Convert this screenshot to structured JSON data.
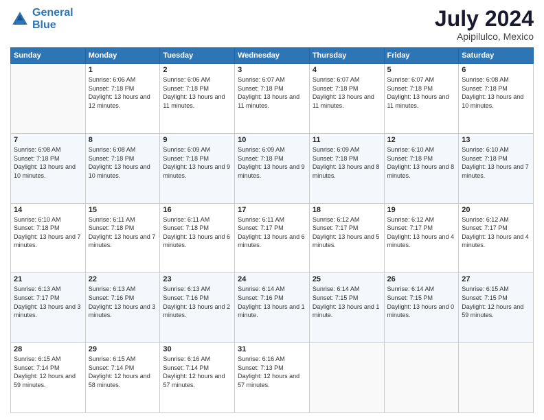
{
  "logo": {
    "line1": "General",
    "line2": "Blue"
  },
  "title": "July 2024",
  "location": "Apipilulco, Mexico",
  "weekdays": [
    "Sunday",
    "Monday",
    "Tuesday",
    "Wednesday",
    "Thursday",
    "Friday",
    "Saturday"
  ],
  "weeks": [
    [
      {
        "day": "",
        "sunrise": "",
        "sunset": "",
        "daylight": ""
      },
      {
        "day": "1",
        "sunrise": "Sunrise: 6:06 AM",
        "sunset": "Sunset: 7:18 PM",
        "daylight": "Daylight: 13 hours and 12 minutes."
      },
      {
        "day": "2",
        "sunrise": "Sunrise: 6:06 AM",
        "sunset": "Sunset: 7:18 PM",
        "daylight": "Daylight: 13 hours and 11 minutes."
      },
      {
        "day": "3",
        "sunrise": "Sunrise: 6:07 AM",
        "sunset": "Sunset: 7:18 PM",
        "daylight": "Daylight: 13 hours and 11 minutes."
      },
      {
        "day": "4",
        "sunrise": "Sunrise: 6:07 AM",
        "sunset": "Sunset: 7:18 PM",
        "daylight": "Daylight: 13 hours and 11 minutes."
      },
      {
        "day": "5",
        "sunrise": "Sunrise: 6:07 AM",
        "sunset": "Sunset: 7:18 PM",
        "daylight": "Daylight: 13 hours and 11 minutes."
      },
      {
        "day": "6",
        "sunrise": "Sunrise: 6:08 AM",
        "sunset": "Sunset: 7:18 PM",
        "daylight": "Daylight: 13 hours and 10 minutes."
      }
    ],
    [
      {
        "day": "7",
        "sunrise": "Sunrise: 6:08 AM",
        "sunset": "Sunset: 7:18 PM",
        "daylight": "Daylight: 13 hours and 10 minutes."
      },
      {
        "day": "8",
        "sunrise": "Sunrise: 6:08 AM",
        "sunset": "Sunset: 7:18 PM",
        "daylight": "Daylight: 13 hours and 10 minutes."
      },
      {
        "day": "9",
        "sunrise": "Sunrise: 6:09 AM",
        "sunset": "Sunset: 7:18 PM",
        "daylight": "Daylight: 13 hours and 9 minutes."
      },
      {
        "day": "10",
        "sunrise": "Sunrise: 6:09 AM",
        "sunset": "Sunset: 7:18 PM",
        "daylight": "Daylight: 13 hours and 9 minutes."
      },
      {
        "day": "11",
        "sunrise": "Sunrise: 6:09 AM",
        "sunset": "Sunset: 7:18 PM",
        "daylight": "Daylight: 13 hours and 8 minutes."
      },
      {
        "day": "12",
        "sunrise": "Sunrise: 6:10 AM",
        "sunset": "Sunset: 7:18 PM",
        "daylight": "Daylight: 13 hours and 8 minutes."
      },
      {
        "day": "13",
        "sunrise": "Sunrise: 6:10 AM",
        "sunset": "Sunset: 7:18 PM",
        "daylight": "Daylight: 13 hours and 7 minutes."
      }
    ],
    [
      {
        "day": "14",
        "sunrise": "Sunrise: 6:10 AM",
        "sunset": "Sunset: 7:18 PM",
        "daylight": "Daylight: 13 hours and 7 minutes."
      },
      {
        "day": "15",
        "sunrise": "Sunrise: 6:11 AM",
        "sunset": "Sunset: 7:18 PM",
        "daylight": "Daylight: 13 hours and 7 minutes."
      },
      {
        "day": "16",
        "sunrise": "Sunrise: 6:11 AM",
        "sunset": "Sunset: 7:18 PM",
        "daylight": "Daylight: 13 hours and 6 minutes."
      },
      {
        "day": "17",
        "sunrise": "Sunrise: 6:11 AM",
        "sunset": "Sunset: 7:17 PM",
        "daylight": "Daylight: 13 hours and 6 minutes."
      },
      {
        "day": "18",
        "sunrise": "Sunrise: 6:12 AM",
        "sunset": "Sunset: 7:17 PM",
        "daylight": "Daylight: 13 hours and 5 minutes."
      },
      {
        "day": "19",
        "sunrise": "Sunrise: 6:12 AM",
        "sunset": "Sunset: 7:17 PM",
        "daylight": "Daylight: 13 hours and 4 minutes."
      },
      {
        "day": "20",
        "sunrise": "Sunrise: 6:12 AM",
        "sunset": "Sunset: 7:17 PM",
        "daylight": "Daylight: 13 hours and 4 minutes."
      }
    ],
    [
      {
        "day": "21",
        "sunrise": "Sunrise: 6:13 AM",
        "sunset": "Sunset: 7:17 PM",
        "daylight": "Daylight: 13 hours and 3 minutes."
      },
      {
        "day": "22",
        "sunrise": "Sunrise: 6:13 AM",
        "sunset": "Sunset: 7:16 PM",
        "daylight": "Daylight: 13 hours and 3 minutes."
      },
      {
        "day": "23",
        "sunrise": "Sunrise: 6:13 AM",
        "sunset": "Sunset: 7:16 PM",
        "daylight": "Daylight: 13 hours and 2 minutes."
      },
      {
        "day": "24",
        "sunrise": "Sunrise: 6:14 AM",
        "sunset": "Sunset: 7:16 PM",
        "daylight": "Daylight: 13 hours and 1 minute."
      },
      {
        "day": "25",
        "sunrise": "Sunrise: 6:14 AM",
        "sunset": "Sunset: 7:15 PM",
        "daylight": "Daylight: 13 hours and 1 minute."
      },
      {
        "day": "26",
        "sunrise": "Sunrise: 6:14 AM",
        "sunset": "Sunset: 7:15 PM",
        "daylight": "Daylight: 13 hours and 0 minutes."
      },
      {
        "day": "27",
        "sunrise": "Sunrise: 6:15 AM",
        "sunset": "Sunset: 7:15 PM",
        "daylight": "Daylight: 12 hours and 59 minutes."
      }
    ],
    [
      {
        "day": "28",
        "sunrise": "Sunrise: 6:15 AM",
        "sunset": "Sunset: 7:14 PM",
        "daylight": "Daylight: 12 hours and 59 minutes."
      },
      {
        "day": "29",
        "sunrise": "Sunrise: 6:15 AM",
        "sunset": "Sunset: 7:14 PM",
        "daylight": "Daylight: 12 hours and 58 minutes."
      },
      {
        "day": "30",
        "sunrise": "Sunrise: 6:16 AM",
        "sunset": "Sunset: 7:14 PM",
        "daylight": "Daylight: 12 hours and 57 minutes."
      },
      {
        "day": "31",
        "sunrise": "Sunrise: 6:16 AM",
        "sunset": "Sunset: 7:13 PM",
        "daylight": "Daylight: 12 hours and 57 minutes."
      },
      {
        "day": "",
        "sunrise": "",
        "sunset": "",
        "daylight": ""
      },
      {
        "day": "",
        "sunrise": "",
        "sunset": "",
        "daylight": ""
      },
      {
        "day": "",
        "sunrise": "",
        "sunset": "",
        "daylight": ""
      }
    ]
  ]
}
